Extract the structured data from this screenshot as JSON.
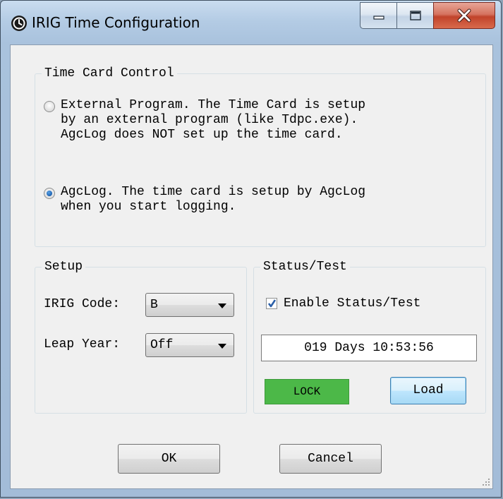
{
  "window": {
    "title": "IRIG Time Configuration"
  },
  "time_card_control": {
    "legend": "Time Card Control",
    "options": [
      {
        "label": "External Program. The Time Card is setup\nby an external program (like Tdpc.exe).\nAgcLog does NOT set up the time card.",
        "selected": false
      },
      {
        "label": "AgcLog. The time card is setup by AgcLog\nwhen you start logging.",
        "selected": true
      }
    ]
  },
  "setup": {
    "legend": "Setup",
    "irig_code_label": "IRIG Code:",
    "irig_code_value": "B",
    "leap_year_label": "Leap Year:",
    "leap_year_value": "Off"
  },
  "status_test": {
    "legend": "Status/Test",
    "enable_label": "Enable Status/Test",
    "enable_checked": true,
    "time_display": "019 Days 10:53:56",
    "lock_label": "LOCK",
    "lock_color": "#4cb848",
    "load_label": "Load"
  },
  "footer": {
    "ok_label": "OK",
    "cancel_label": "Cancel"
  }
}
